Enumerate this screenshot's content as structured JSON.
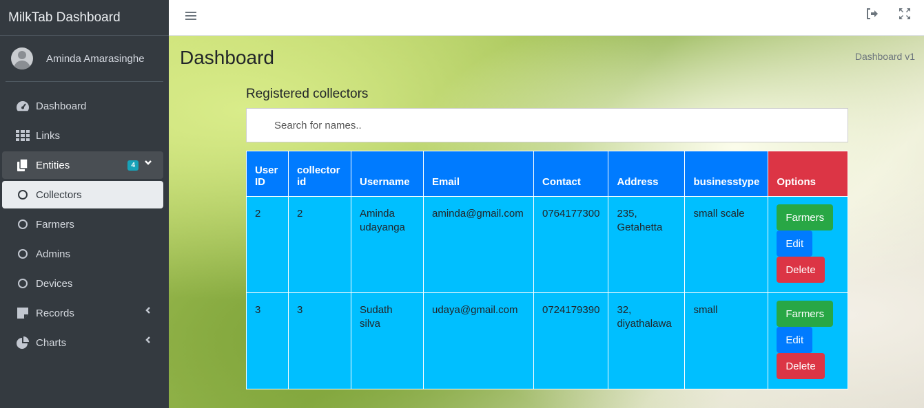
{
  "sidebar": {
    "brand": "MilkTab Dashboard",
    "user": "Aminda Amarasinghe",
    "items": [
      {
        "label": "Dashboard",
        "icon": "tachometer-icon"
      },
      {
        "label": "Links",
        "icon": "grid-icon"
      },
      {
        "label": "Entities",
        "icon": "copy-icon",
        "badge": "4",
        "state": "open"
      },
      {
        "label": "Collectors",
        "icon": "circle-icon",
        "state": "active"
      },
      {
        "label": "Farmers",
        "icon": "circle-icon"
      },
      {
        "label": "Admins",
        "icon": "circle-icon"
      },
      {
        "label": "Devices",
        "icon": "circle-icon"
      },
      {
        "label": "Records",
        "icon": "sticky-note-icon"
      },
      {
        "label": "Charts",
        "icon": "pie-chart-icon"
      }
    ]
  },
  "header": {
    "title": "Dashboard",
    "breadcrumb": "Dashboard v1"
  },
  "main": {
    "section_title": "Registered collectors",
    "search_placeholder": "Search for names..",
    "columns": [
      "User ID",
      "collector id",
      "Username",
      "Email",
      "Contact",
      "Address",
      "businesstype",
      "Options"
    ],
    "rows": [
      {
        "user_id": "2",
        "collector_id": "2",
        "username": "Aminda udayanga",
        "email": "aminda@gmail.com",
        "contact": "0764177300",
        "address": "235, Getahetta",
        "businesstype": "small scale"
      },
      {
        "user_id": "3",
        "collector_id": "3",
        "username": "Sudath silva",
        "email": "udaya@gmail.com",
        "contact": "0724179390",
        "address": "32, diyathalawa",
        "businesstype": "small"
      }
    ],
    "buttons": {
      "farmers": "Farmers",
      "edit": "Edit",
      "delete": "Delete"
    }
  },
  "colors": {
    "sidebar": "#343a40",
    "header_row": "#007bff",
    "options_header": "#dc3545",
    "row_bg": "#00bfff",
    "success": "#28a745",
    "danger": "#dc3545",
    "badge": "#17a2b8"
  }
}
